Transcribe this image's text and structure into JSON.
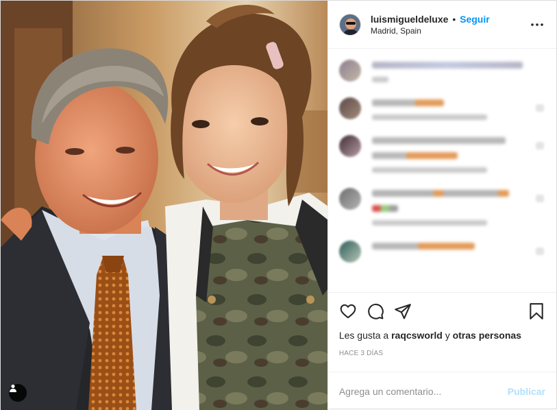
{
  "post": {
    "username": "luismigueldeluxe",
    "separator": "•",
    "follow_label": "Seguir",
    "location": "Madrid, Spain",
    "more_icon": "more-horizontal-icon"
  },
  "actions": {
    "like_icon": "heart-icon",
    "comment_icon": "comment-bubble-icon",
    "share_icon": "paper-plane-icon",
    "save_icon": "bookmark-icon"
  },
  "likes": {
    "prefix": "Les gusta a",
    "user": "raqcsworld",
    "joiner": "y",
    "others": "otras personas"
  },
  "time_ago": "HACE 3 DÍAS",
  "comment_box": {
    "placeholder": "Agrega un comentario...",
    "publish_label": "Publicar"
  },
  "colors": {
    "accent": "#0095f6",
    "publish_disabled": "#b2dffc",
    "muted": "#8e8e8e"
  }
}
